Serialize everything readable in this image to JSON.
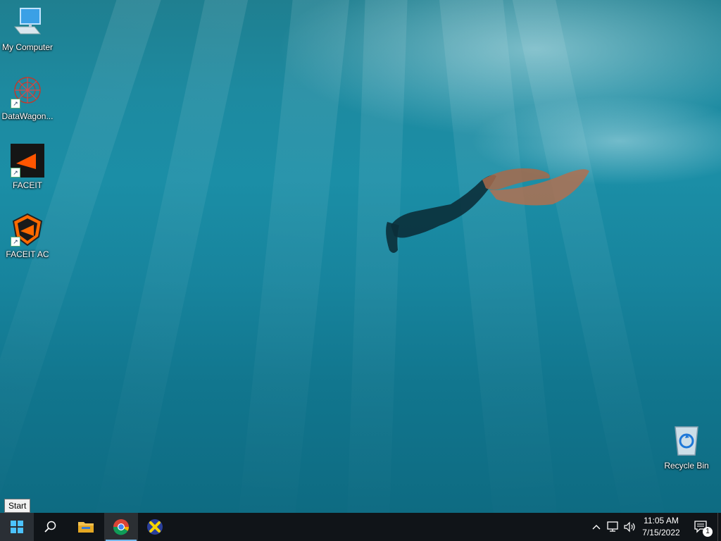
{
  "desktop": {
    "icons": [
      {
        "label": "My Computer",
        "icon": "computer-icon"
      },
      {
        "label": "DataWagon...",
        "icon": "datawagon-icon"
      },
      {
        "label": "FACEIT",
        "icon": "faceit-icon"
      },
      {
        "label": "FACEIT AC",
        "icon": "faceit-ac-icon"
      }
    ],
    "recycle_bin": {
      "label": "Recycle Bin",
      "icon": "recycle-bin-icon"
    }
  },
  "tooltip": {
    "text": "Start"
  },
  "taskbar": {
    "clock": {
      "time": "11:05 AM",
      "date": "7/15/2022"
    },
    "notification_count": "1",
    "accent": "#76b9ed"
  }
}
